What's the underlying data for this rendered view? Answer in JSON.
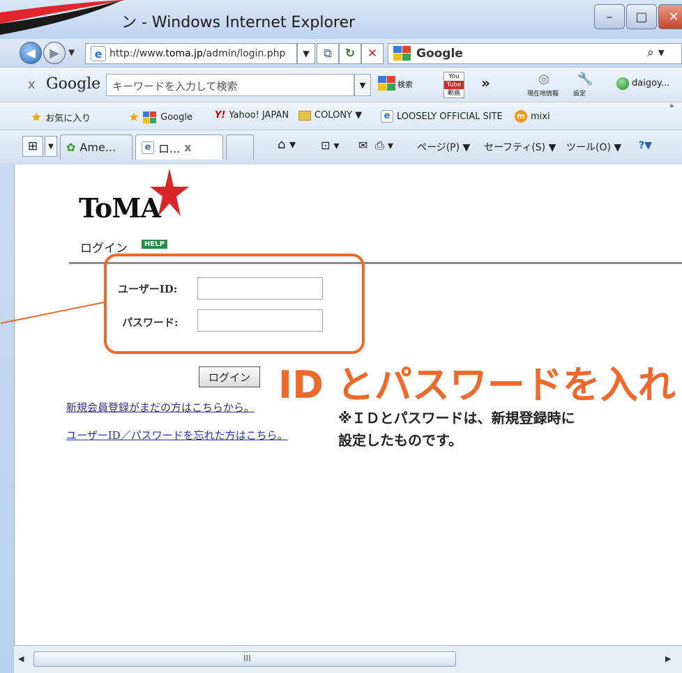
{
  "window": {
    "title": "ン - Windows Internet Explorer",
    "min_glyph": "–",
    "max_glyph": "□",
    "close_glyph": "✕"
  },
  "address": {
    "url_prefix": "http://www.",
    "url_domain": "toma.jp",
    "url_path": "/admin/login.php",
    "search_engine": "Google"
  },
  "google_toolbar": {
    "close": "x",
    "logo": "Google",
    "search_placeholder": "キーワードを入力して検索",
    "search_button": "検索",
    "youtube_top": "You",
    "youtube_mid": "Tube",
    "youtube_bottom": "動画",
    "more": "»",
    "geo_label": "現在地情報",
    "settings_label": "設定",
    "user": "daigoy..."
  },
  "favorites": {
    "favorites_label": "お気に入り",
    "items": [
      "Google",
      "Yahoo! JAPAN",
      "COLONY ▼",
      "LOOSELY OFFICIAL SITE",
      "mixi"
    ],
    "yahoo_mark": "Y!",
    "mixi_mark": "m"
  },
  "tabs": {
    "items": [
      {
        "label": "Ame..."
      },
      {
        "label": "ロ..."
      }
    ],
    "close": "x"
  },
  "commands": {
    "page": "ページ(P) ▼",
    "safety": "セーフティ(S) ▼",
    "tools": "ツール(O) ▼",
    "help": "?▼"
  },
  "page": {
    "logo": "ToMA",
    "heading": "ログイン",
    "help_badge": "HELP",
    "userid_label": "ユーザーID:",
    "password_label": "パスワード:",
    "userid_value": "",
    "password_value": "",
    "login_button": "ログイン",
    "link_register": "新規会員登録がまだの方はこちらから。",
    "link_forgot": "ユーザーID／パスワードを忘れた方はこちら。"
  },
  "annotation": {
    "title": "ID とパスワードを入れ",
    "note_line1": "※ＩＤとパスワードは、新規登録時に",
    "note_line2": "設定したものです。",
    "color": "#ee6a2c"
  },
  "scrollbar": {
    "grip": "III"
  }
}
